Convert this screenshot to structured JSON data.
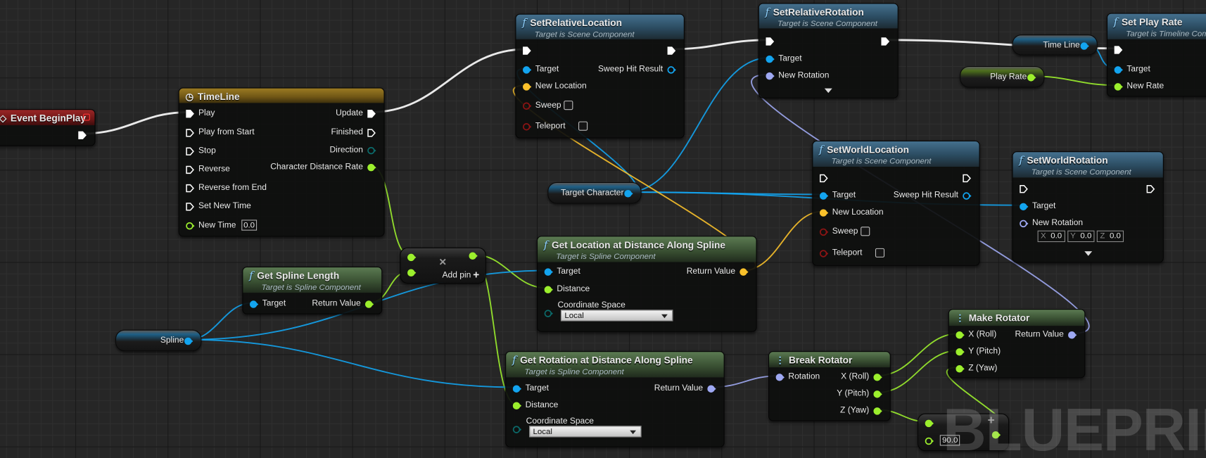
{
  "watermark": "BLUEPRINT",
  "pin_colors": {
    "exec": "#ffffff",
    "float": "#9cef2d",
    "object": "#13a4ef",
    "vector": "#f9c12b",
    "rotator": "#9ea8f2",
    "enum": "#0b6b6b",
    "bool": "#8c1414"
  },
  "nodes": {
    "ebp": {
      "title": "Event BeginPlay",
      "outputs": [
        {
          "label": "",
          "type": "exec",
          "connected": true
        }
      ]
    },
    "timeline": {
      "title": "TimeLine",
      "inputs": [
        {
          "label": "Play",
          "type": "exec",
          "connected": true
        },
        {
          "label": "Play from Start",
          "type": "exec"
        },
        {
          "label": "Stop",
          "type": "exec"
        },
        {
          "label": "Reverse",
          "type": "exec"
        },
        {
          "label": "Reverse from End",
          "type": "exec"
        },
        {
          "label": "Set New Time",
          "type": "exec"
        },
        {
          "label": "New Time",
          "type": "float",
          "value": "0.0"
        }
      ],
      "outputs": [
        {
          "label": "Update",
          "type": "exec",
          "connected": true
        },
        {
          "label": "Finished",
          "type": "exec"
        },
        {
          "label": "Direction",
          "type": "enum"
        },
        {
          "label": "Character Distance Rate",
          "type": "float",
          "connected": true
        }
      ]
    },
    "srl": {
      "title": "SetRelativeLocation",
      "subtitle": "Target is Scene Component",
      "inputs": [
        {
          "label": "",
          "type": "exec",
          "connected": true
        },
        {
          "label": "Target",
          "type": "object",
          "connected": true
        },
        {
          "label": "New Location",
          "type": "vector",
          "connected": true
        },
        {
          "label": "Sweep",
          "type": "bool",
          "checkbox": true
        },
        {
          "label": "Teleport",
          "type": "bool",
          "checkbox": true
        }
      ],
      "outputs": [
        {
          "label": "",
          "type": "exec",
          "connected": true
        },
        {
          "label": "Sweep Hit Result",
          "type": "object"
        }
      ]
    },
    "srr": {
      "title": "SetRelativeRotation",
      "subtitle": "Target is Scene Component",
      "inputs": [
        {
          "label": "",
          "type": "exec",
          "connected": true
        },
        {
          "label": "Target",
          "type": "object",
          "connected": true
        },
        {
          "label": "New Rotation",
          "type": "rotator",
          "connected": true
        }
      ],
      "outputs": [
        {
          "label": "",
          "type": "exec",
          "connected": true
        }
      ],
      "expand": true
    },
    "spr": {
      "title": "Set Play Rate",
      "subtitle": "Target is Timeline Component",
      "inputs": [
        {
          "label": "",
          "type": "exec",
          "connected": true
        },
        {
          "label": "Target",
          "type": "object",
          "connected": true
        },
        {
          "label": "New Rate",
          "type": "float",
          "connected": true
        }
      ],
      "outputs": []
    },
    "swl": {
      "title": "SetWorldLocation",
      "subtitle": "Target is Scene Component",
      "inputs": [
        {
          "label": "",
          "type": "exec"
        },
        {
          "label": "Target",
          "type": "object",
          "connected": true
        },
        {
          "label": "New Location",
          "type": "vector",
          "connected": true
        },
        {
          "label": "Sweep",
          "type": "bool",
          "checkbox": true
        },
        {
          "label": "Teleport",
          "type": "bool",
          "checkbox": true
        }
      ],
      "outputs": [
        {
          "label": "",
          "type": "exec"
        },
        {
          "label": "Sweep Hit Result",
          "type": "object"
        }
      ]
    },
    "swr": {
      "title": "SetWorldRotation",
      "subtitle": "Target is Scene Component",
      "inputs": [
        {
          "label": "",
          "type": "exec"
        },
        {
          "label": "Target",
          "type": "object",
          "connected": true
        },
        {
          "label": "New Rotation",
          "type": "rotator",
          "xyz": {
            "x": "0.0",
            "y": "0.0",
            "z": "0.0"
          }
        }
      ],
      "outputs": [
        {
          "label": "",
          "type": "exec"
        }
      ],
      "expand": true
    },
    "gsl": {
      "title": "Get Spline Length",
      "subtitle": "Target is Spline Component",
      "inputs": [
        {
          "label": "Target",
          "type": "object",
          "connected": true
        }
      ],
      "outputs": [
        {
          "label": "Return Value",
          "type": "float",
          "connected": true
        }
      ]
    },
    "mul": {
      "title": "",
      "add_pin_label": "Add pin",
      "operator": "×",
      "inputs": [
        {
          "label": "",
          "type": "float",
          "connected": true
        },
        {
          "label": "",
          "type": "float",
          "connected": true
        }
      ],
      "outputs": [
        {
          "label": "",
          "type": "float",
          "connected": true
        }
      ]
    },
    "gld": {
      "title": "Get Location at Distance Along Spline",
      "subtitle": "Target is Spline Component",
      "inputs": [
        {
          "label": "Target",
          "type": "object",
          "connected": true
        },
        {
          "label": "Distance",
          "type": "float",
          "connected": true
        },
        {
          "label": "Coordinate Space",
          "type": "enum",
          "dropdown": "Local"
        }
      ],
      "outputs": [
        {
          "label": "Return Value",
          "type": "vector",
          "connected": true
        }
      ]
    },
    "grd": {
      "title": "Get Rotation at Distance Along Spline",
      "subtitle": "Target is Spline Component",
      "inputs": [
        {
          "label": "Target",
          "type": "object",
          "connected": true
        },
        {
          "label": "Distance",
          "type": "float",
          "connected": true
        },
        {
          "label": "Coordinate Space",
          "type": "enum",
          "dropdown": "Local"
        }
      ],
      "outputs": [
        {
          "label": "Return Value",
          "type": "rotator",
          "connected": true
        }
      ]
    },
    "br": {
      "title": "Break Rotator",
      "inputs": [
        {
          "label": "Rotation",
          "type": "rotator",
          "connected": true
        }
      ],
      "outputs": [
        {
          "label": "X (Roll)",
          "type": "float",
          "connected": true
        },
        {
          "label": "Y (Pitch)",
          "type": "float",
          "connected": true
        },
        {
          "label": "Z (Yaw)",
          "type": "float",
          "connected": true
        }
      ]
    },
    "mr": {
      "title": "Make Rotator",
      "inputs": [
        {
          "label": "X (Roll)",
          "type": "float",
          "connected": true
        },
        {
          "label": "Y (Pitch)",
          "type": "float",
          "connected": true
        },
        {
          "label": "Z (Yaw)",
          "type": "float",
          "connected": true
        }
      ],
      "outputs": [
        {
          "label": "Return Value",
          "type": "rotator",
          "connected": true
        }
      ]
    },
    "add": {
      "title": "",
      "operator": "+",
      "inputs": [
        {
          "label": "",
          "type": "float",
          "connected": true
        },
        {
          "label": "",
          "type": "float",
          "value": "90.0"
        }
      ],
      "outputs": [
        {
          "label": "",
          "type": "float",
          "connected": true
        }
      ]
    }
  },
  "variables": {
    "time_line": {
      "label": "Time Line",
      "type": "object"
    },
    "play_rate": {
      "label": "Play Rate",
      "type": "float"
    },
    "target_character": {
      "label": "Target Character",
      "type": "object"
    },
    "spline": {
      "label": "Spline",
      "type": "object"
    }
  }
}
